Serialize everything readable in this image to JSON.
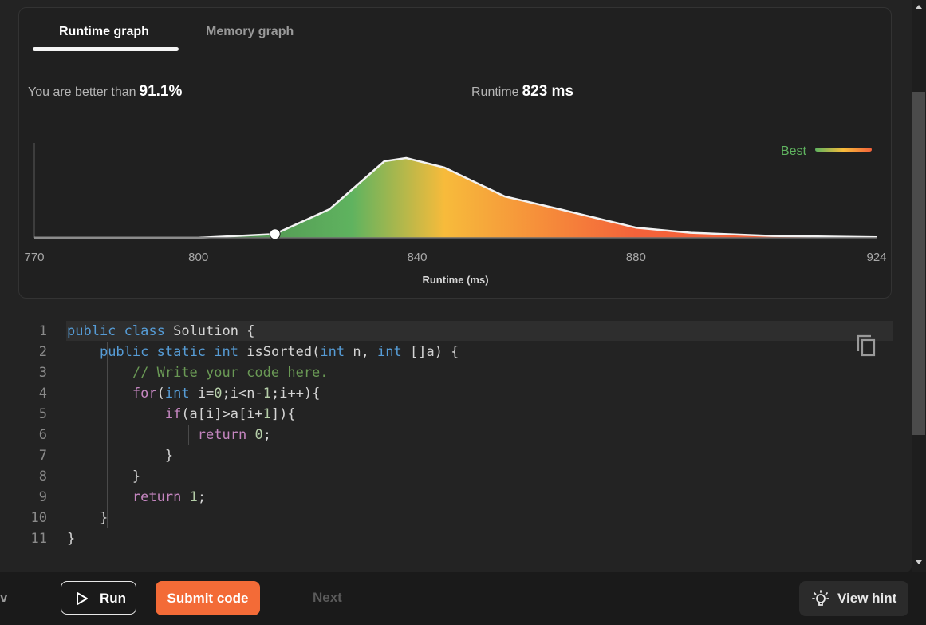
{
  "tabs": [
    {
      "label": "Runtime graph",
      "active": true
    },
    {
      "label": "Memory graph",
      "active": false
    }
  ],
  "stats": {
    "better_label": "You are better than",
    "better_value": "91.1%",
    "runtime_label": "Runtime",
    "runtime_value": "823 ms"
  },
  "legend": {
    "label": "Best"
  },
  "chart_data": {
    "type": "area",
    "xlabel": "Runtime (ms)",
    "xlim": [
      770,
      924
    ],
    "x_ticks": [
      "770",
      "800",
      "840",
      "880",
      "924"
    ],
    "x": [
      770,
      800,
      814,
      824,
      834,
      838,
      845,
      856,
      866,
      880,
      890,
      905,
      924
    ],
    "y": [
      0,
      0,
      0.6,
      4.5,
      12,
      12.5,
      11,
      6.5,
      4.5,
      1.6,
      0.8,
      0.3,
      0.1
    ],
    "highlight": {
      "x": 814,
      "y": 0.6
    },
    "colors": {
      "low": "#5fb35f",
      "mid": "#f7bb3b",
      "high": "#f4623a"
    }
  },
  "editor": {
    "lines": [
      {
        "n": "1",
        "tokens": [
          {
            "t": "kw",
            "v": "public"
          },
          {
            "t": "p",
            "v": " "
          },
          {
            "t": "kw",
            "v": "class"
          },
          {
            "t": "p",
            "v": " Solution {"
          }
        ]
      },
      {
        "n": "2",
        "tokens": [
          {
            "t": "p",
            "v": "    "
          },
          {
            "t": "kw",
            "v": "public"
          },
          {
            "t": "p",
            "v": " "
          },
          {
            "t": "kw",
            "v": "static"
          },
          {
            "t": "p",
            "v": " "
          },
          {
            "t": "kw",
            "v": "int"
          },
          {
            "t": "p",
            "v": " isSorted("
          },
          {
            "t": "kw",
            "v": "int"
          },
          {
            "t": "p",
            "v": " n, "
          },
          {
            "t": "kw",
            "v": "int"
          },
          {
            "t": "p",
            "v": " []a) {"
          }
        ]
      },
      {
        "n": "3",
        "tokens": [
          {
            "t": "p",
            "v": "        "
          },
          {
            "t": "cm",
            "v": "// Write your code here."
          }
        ]
      },
      {
        "n": "4",
        "tokens": [
          {
            "t": "p",
            "v": "        "
          },
          {
            "t": "kw2",
            "v": "for"
          },
          {
            "t": "p",
            "v": "("
          },
          {
            "t": "kw",
            "v": "int"
          },
          {
            "t": "p",
            "v": " i="
          },
          {
            "t": "num",
            "v": "0"
          },
          {
            "t": "p",
            "v": ";i<n-"
          },
          {
            "t": "num",
            "v": "1"
          },
          {
            "t": "p",
            "v": ";i++){"
          }
        ]
      },
      {
        "n": "5",
        "tokens": [
          {
            "t": "p",
            "v": "            "
          },
          {
            "t": "kw2",
            "v": "if"
          },
          {
            "t": "p",
            "v": "(a[i]>a[i+"
          },
          {
            "t": "num",
            "v": "1"
          },
          {
            "t": "p",
            "v": "]){"
          }
        ]
      },
      {
        "n": "6",
        "tokens": [
          {
            "t": "p",
            "v": "                "
          },
          {
            "t": "kw2",
            "v": "return"
          },
          {
            "t": "p",
            "v": " "
          },
          {
            "t": "num",
            "v": "0"
          },
          {
            "t": "p",
            "v": ";"
          }
        ]
      },
      {
        "n": "7",
        "tokens": [
          {
            "t": "p",
            "v": "            }"
          }
        ]
      },
      {
        "n": "8",
        "tokens": [
          {
            "t": "p",
            "v": "        }"
          }
        ]
      },
      {
        "n": "9",
        "tokens": [
          {
            "t": "p",
            "v": "        "
          },
          {
            "t": "kw2",
            "v": "return"
          },
          {
            "t": "p",
            "v": " "
          },
          {
            "t": "num",
            "v": "1"
          },
          {
            "t": "p",
            "v": ";"
          }
        ]
      },
      {
        "n": "10",
        "tokens": [
          {
            "t": "p",
            "v": "    }"
          }
        ]
      },
      {
        "n": "11",
        "tokens": [
          {
            "t": "p",
            "v": "}"
          }
        ]
      }
    ]
  },
  "footer": {
    "prev_label": "v",
    "run_label": "Run",
    "submit_label": "Submit code",
    "next_label": "Next",
    "hint_label": "View hint"
  },
  "icons": {
    "run": "play-icon",
    "hint": "lightbulb-icon",
    "copy": "copy-icon"
  }
}
